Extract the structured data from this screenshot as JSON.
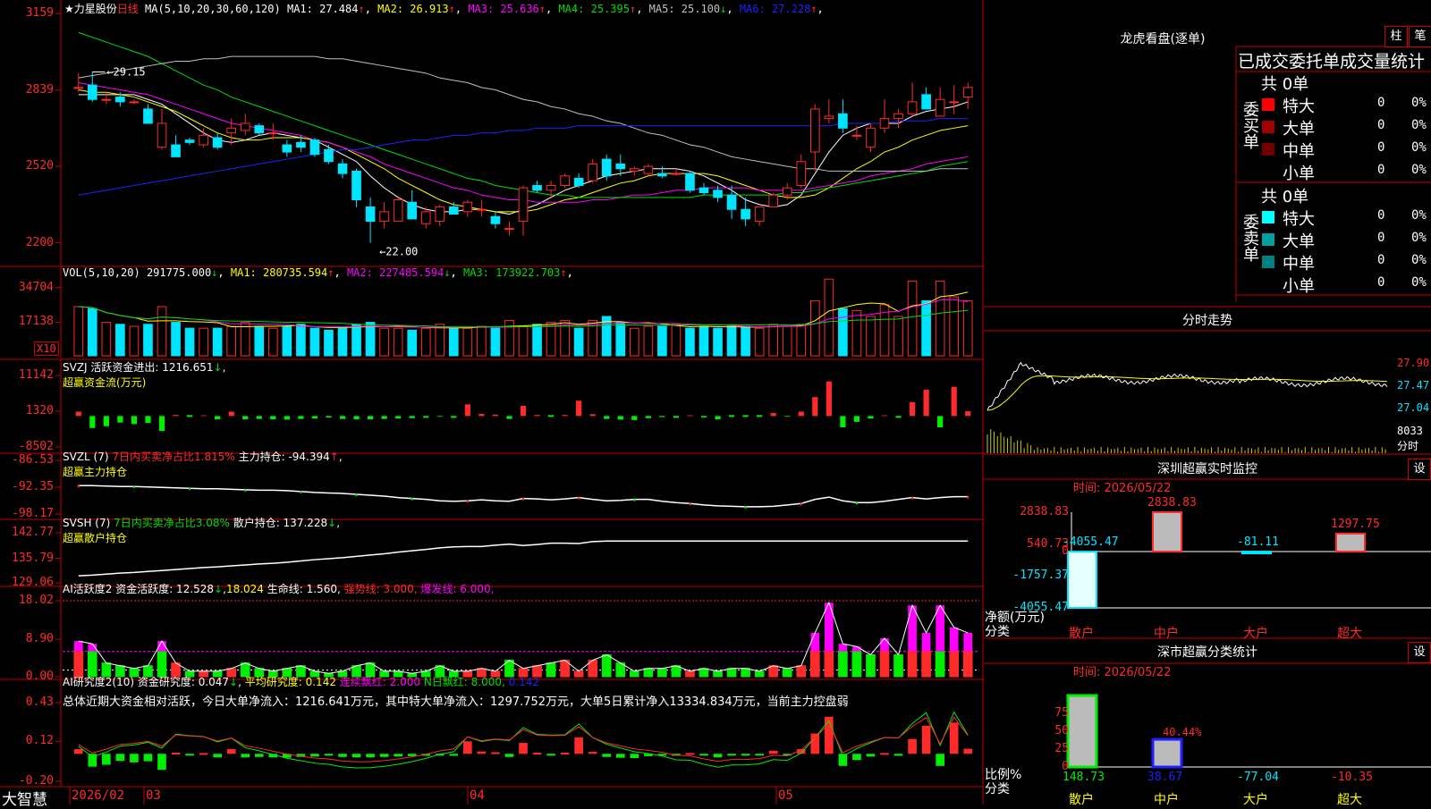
{
  "colors": {
    "up": "#ff2a2a",
    "down": "#00e5ff",
    "ma1": "#ffffff",
    "ma2": "#ffff00",
    "ma3": "#ff00ff",
    "ma4": "#00dd00",
    "ma5": "#c0c0c0",
    "ma6": "#2020ff",
    "grid": "#c00000",
    "accent": "#ffff00"
  },
  "main": {
    "title": "★力星股份",
    "period": "日线",
    "ma_label": "MA(5,10,20,30,60,120)",
    "ma_values": [
      {
        "text": "MA1: 27.484",
        "arrow": "↑",
        "color": "#ffffff"
      },
      {
        "text": "MA2: 26.913",
        "arrow": "↑",
        "color": "#ffff00"
      },
      {
        "text": "MA3: 25.636",
        "arrow": "↑",
        "color": "#ff00ff"
      },
      {
        "text": "MA4: 25.395",
        "arrow": "↑",
        "color": "#00dd00"
      },
      {
        "text": "MA5: 25.100",
        "arrow": "↓",
        "color": "#c0c0c0"
      },
      {
        "text": "MA6: 27.228",
        "arrow": "↑",
        "color": "#2020ff"
      }
    ],
    "y_labels": [
      "3159",
      "2839",
      "2520",
      "2200"
    ],
    "high_mark": "29.15",
    "low_mark": "22.00"
  },
  "vol": {
    "label": "VOL(5,10,20)",
    "value": "291775.000",
    "arrow": "↓",
    "ma": [
      {
        "text": "MA1: 280735.594",
        "arrow": "↑",
        "color": "#ffff00"
      },
      {
        "text": "MA2: 227485.594",
        "arrow": "↓",
        "color": "#ff00ff"
      },
      {
        "text": "MA3: 173922.703",
        "arrow": "↑",
        "color": "#00dd00"
      }
    ],
    "y_labels": [
      "34704",
      "17138"
    ],
    "unit": "X10"
  },
  "svzj": {
    "label": "SVZJ  活跃资金进出: 1216.651",
    "arrow": "↓",
    "sub": "超赢资金流(万元)",
    "y_labels": [
      "11142",
      "1320",
      "-8502"
    ]
  },
  "svzl": {
    "label": "SVZL (7)",
    "mid": "7日内买卖净占比1.815%",
    "tail": " 主力持仓: -94.394",
    "arrow": "↑",
    "tail2": ",",
    "sub": "超赢主力持仓",
    "y_labels": [
      "-86.53",
      "-92.35",
      "-98.17"
    ]
  },
  "svsh": {
    "label": "SVSH (7)",
    "mid": "7日内买卖净占比3.08%",
    "tail": " 散户持仓: 137.228",
    "arrow": "↓",
    "tail2": ",",
    "sub": "超赢散户持仓",
    "y_labels": [
      "142.77",
      "135.79",
      "129.06"
    ]
  },
  "ai1": {
    "label": "AI活跃度2 资金活跃度: 12.528",
    "arrow": "↓",
    "parts": [
      {
        "text": "18.024",
        "color": "#ffff00"
      },
      {
        "text": " 生命线: 1.560,",
        "color": "#ffffff"
      },
      {
        "text": " 强势线: 3.000,",
        "color": "#ff2a2a"
      },
      {
        "text": " 爆发线: 6.000,",
        "color": "#ff00ff"
      }
    ],
    "y_labels": [
      "18.02",
      "8.90",
      "0.00"
    ]
  },
  "ai2": {
    "label": "AI研究度2(10) 资金研究度: 0.047",
    "arrow": "↓",
    "parts": [
      {
        "text": " 平均研究度: 0.142",
        "color": "#ffff00"
      },
      {
        "text": " 连续飘红: 2.000",
        "color": "#ff00ff"
      },
      {
        "text": " N日飘红: 8.000,",
        "color": "#00dd00"
      },
      {
        "text": " 0.142",
        "color": "#2020ff"
      }
    ],
    "summary": "总体近期大资金相对活跃，今日大单净流入：1216.641万元，其中特大单净流入：1297.752万元，大单5日累计净入13334.834万元，当前主力控盘弱",
    "y_labels": [
      "0.43",
      "0.12",
      "-0.20"
    ]
  },
  "x_axis": {
    "brand": "大智慧",
    "labels": [
      "2026/02",
      "03",
      "04",
      "05"
    ]
  },
  "right": {
    "lhb": {
      "title": "龙虎看盘(逐单)",
      "btn_zhu": "柱",
      "btn_bi": "笔",
      "tabs": "已成交委托单成交量统计",
      "buy": {
        "side": "委买单",
        "total": "共 0单",
        "rows": [
          {
            "name": "特大",
            "val": "0",
            "pct": "0%",
            "color": "#ff0000"
          },
          {
            "name": "大单",
            "val": "0",
            "pct": "0%",
            "color": "#a00000"
          },
          {
            "name": "中单",
            "val": "0",
            "pct": "0%",
            "color": "#700000"
          },
          {
            "name": "小单",
            "val": "0",
            "pct": "0%",
            "color": ""
          }
        ]
      },
      "sell": {
        "side": "委卖单",
        "total": "共 0单",
        "rows": [
          {
            "name": "特大",
            "val": "0",
            "pct": "0%",
            "color": "#00ffff"
          },
          {
            "name": "大单",
            "val": "0",
            "pct": "0%",
            "color": "#00a0a0"
          },
          {
            "name": "中单",
            "val": "0",
            "pct": "0%",
            "color": "#008080"
          },
          {
            "name": "小单",
            "val": "0",
            "pct": "0%",
            "color": ""
          }
        ]
      }
    },
    "fenshi": {
      "title": "分时走势",
      "y_labels": [
        "27.90",
        "27.47",
        "27.04"
      ],
      "vol_label": "8033",
      "vol_unit": "分时"
    },
    "monitor": {
      "title": "深圳超赢实时监控",
      "btn": "设",
      "time": "时间: 2026/05/22",
      "y_labels": [
        "2838.83",
        "540.73",
        "0",
        "-1757.37",
        "-4055.47"
      ],
      "axis_title": "净额(万元)",
      "axis_sub": "分类",
      "bars": [
        {
          "cat": "散户",
          "value": "-4055.47"
        },
        {
          "cat": "中户",
          "value": "2838.83"
        },
        {
          "cat": "大户",
          "value": "-81.11"
        },
        {
          "cat": "超大",
          "value": "1297.75"
        }
      ]
    },
    "stats": {
      "title": "深市超赢分类统计",
      "btn": "设",
      "time": "时间: 2026/05/22",
      "y_labels": [
        "75",
        "50",
        "25",
        "0"
      ],
      "axis_title": "比例%",
      "axis_sub": "分类",
      "bars": [
        {
          "cat": "散户",
          "value": "148.73"
        },
        {
          "cat": "中户",
          "value": "38.67"
        },
        {
          "cat": "大户",
          "value": "-77.04"
        },
        {
          "cat": "超大",
          "value": "-10.35"
        }
      ],
      "mid_label": "40.44%"
    }
  },
  "chart_data": {
    "type": "candlestick",
    "candles": [
      [
        28.5,
        29.1,
        28.3,
        28.5
      ],
      [
        28.6,
        29.15,
        27.9,
        28.0
      ],
      [
        28.0,
        28.3,
        27.8,
        28.0
      ],
      [
        28.1,
        28.3,
        27.7,
        27.9
      ],
      [
        27.9,
        28.0,
        27.8,
        27.9
      ],
      [
        27.6,
        27.8,
        27.0,
        27.0
      ],
      [
        26.0,
        27.6,
        25.9,
        27.0
      ],
      [
        26.1,
        26.5,
        25.6,
        25.6
      ],
      [
        26.3,
        26.4,
        26.1,
        26.2
      ],
      [
        26.1,
        26.8,
        26.0,
        26.5
      ],
      [
        26.4,
        26.6,
        25.9,
        26.0
      ],
      [
        26.6,
        27.2,
        26.1,
        26.8
      ],
      [
        26.7,
        27.4,
        26.5,
        27.0
      ],
      [
        26.9,
        27.0,
        26.5,
        26.6
      ],
      [
        26.6,
        27.0,
        26.3,
        26.6
      ],
      [
        26.1,
        26.3,
        25.6,
        25.8
      ],
      [
        26.2,
        26.5,
        25.8,
        26.0
      ],
      [
        26.3,
        26.4,
        25.6,
        25.7
      ],
      [
        25.9,
        26.1,
        25.3,
        25.4
      ],
      [
        25.3,
        25.5,
        24.7,
        24.9
      ],
      [
        25.0,
        25.1,
        23.5,
        23.8
      ],
      [
        23.5,
        23.9,
        22.0,
        22.9
      ],
      [
        22.9,
        23.7,
        22.6,
        23.3
      ],
      [
        22.9,
        23.9,
        22.9,
        23.8
      ],
      [
        23.7,
        24.2,
        23.0,
        23.0
      ],
      [
        22.8,
        23.5,
        22.6,
        23.3
      ],
      [
        22.9,
        23.6,
        22.7,
        23.5
      ],
      [
        23.5,
        23.7,
        23.2,
        23.2
      ],
      [
        23.3,
        23.8,
        23.1,
        23.7
      ],
      [
        23.4,
        23.8,
        23.1,
        23.4
      ],
      [
        23.1,
        23.3,
        22.6,
        22.8
      ],
      [
        22.6,
        22.9,
        22.3,
        22.6
      ],
      [
        22.9,
        24.4,
        22.3,
        24.3
      ],
      [
        24.4,
        24.6,
        24.1,
        24.2
      ],
      [
        24.2,
        24.6,
        23.9,
        24.4
      ],
      [
        24.4,
        24.9,
        24.3,
        24.8
      ],
      [
        24.7,
        24.9,
        24.3,
        24.4
      ],
      [
        24.6,
        25.5,
        24.5,
        25.3
      ],
      [
        25.5,
        25.7,
        24.6,
        24.8
      ],
      [
        25.3,
        25.7,
        24.8,
        25.1
      ],
      [
        25.0,
        25.2,
        24.8,
        25.1
      ],
      [
        24.9,
        25.3,
        24.8,
        25.2
      ],
      [
        24.9,
        25.2,
        24.7,
        24.8
      ],
      [
        24.9,
        25.1,
        24.8,
        24.9
      ],
      [
        24.9,
        25.0,
        24.1,
        24.2
      ],
      [
        24.3,
        24.5,
        24.0,
        24.1
      ],
      [
        24.2,
        24.4,
        23.7,
        23.9
      ],
      [
        24.0,
        24.4,
        23.0,
        23.4
      ],
      [
        23.4,
        23.9,
        22.7,
        23.0
      ],
      [
        22.9,
        23.5,
        22.7,
        23.5
      ],
      [
        23.5,
        24.1,
        23.5,
        24.0
      ],
      [
        24.0,
        24.5,
        23.8,
        24.3
      ],
      [
        24.4,
        25.7,
        24.3,
        25.4
      ],
      [
        25.8,
        27.8,
        25.0,
        27.6
      ],
      [
        27.2,
        28.0,
        27.0,
        27.3
      ],
      [
        27.4,
        28.0,
        26.6,
        26.8
      ],
      [
        26.5,
        26.9,
        26.3,
        26.5
      ],
      [
        26.0,
        27.0,
        25.8,
        26.8
      ],
      [
        26.8,
        28.0,
        26.6,
        27.2
      ],
      [
        27.2,
        27.6,
        26.8,
        27.4
      ],
      [
        27.4,
        28.7,
        27.3,
        27.9
      ],
      [
        28.2,
        28.5,
        27.6,
        27.6
      ],
      [
        27.3,
        28.5,
        27.3,
        28.0
      ],
      [
        27.9,
        28.6,
        27.4,
        27.9
      ],
      [
        28.1,
        28.7,
        27.6,
        28.5
      ]
    ],
    "ma": [
      {
        "name": "MA1",
        "color": "#ffffff",
        "values": [
          28.2,
          28.2,
          28.2,
          28.2,
          28.2,
          28.0,
          27.8,
          27.4,
          27.0,
          26.6,
          26.3,
          26.2,
          26.3,
          26.5,
          26.6,
          26.5,
          26.4,
          26.3,
          26.0,
          25.7,
          25.4,
          24.8,
          24.3,
          23.9,
          23.6,
          23.4,
          23.3,
          23.3,
          23.4,
          23.4,
          23.3,
          23.2,
          23.4,
          23.6,
          23.9,
          24.2,
          24.4,
          24.6,
          24.8,
          24.9,
          25.0,
          25.1,
          25.1,
          25.1,
          25.0,
          24.8,
          24.5,
          24.2,
          23.8,
          23.6,
          23.5,
          23.6,
          24.0,
          24.9,
          25.8,
          26.5,
          26.8,
          27.0,
          27.0,
          27.0,
          27.3,
          27.5,
          27.6,
          27.7,
          27.9
        ]
      },
      {
        "name": "MA2",
        "color": "#ffff00",
        "values": [
          28.4,
          28.3,
          28.3,
          28.2,
          28.1,
          27.9,
          27.7,
          27.5,
          27.2,
          26.9,
          26.6,
          26.4,
          26.3,
          26.3,
          26.4,
          26.4,
          26.4,
          26.3,
          26.2,
          26.0,
          25.7,
          25.4,
          25.1,
          24.7,
          24.4,
          24.1,
          23.8,
          23.6,
          23.5,
          23.4,
          23.3,
          23.3,
          23.3,
          23.4,
          23.6,
          23.8,
          23.9,
          24.1,
          24.3,
          24.5,
          24.6,
          24.8,
          24.9,
          24.9,
          24.9,
          24.9,
          24.8,
          24.6,
          24.4,
          24.2,
          24.0,
          23.9,
          23.9,
          24.0,
          24.3,
          24.7,
          25.1,
          25.4,
          25.8,
          26.0,
          26.3,
          26.5,
          26.7,
          26.8,
          26.9
        ]
      },
      {
        "name": "MA3",
        "color": "#ff00ff",
        "values": [
          28.7,
          28.6,
          28.5,
          28.4,
          28.3,
          28.2,
          28.0,
          27.8,
          27.6,
          27.4,
          27.2,
          27.0,
          26.9,
          26.8,
          26.7,
          26.6,
          26.5,
          26.3,
          26.2,
          26.0,
          25.8,
          25.6,
          25.3,
          25.1,
          24.9,
          24.7,
          24.5,
          24.3,
          24.2,
          24.0,
          23.9,
          23.8,
          23.8,
          23.7,
          23.7,
          23.7,
          23.7,
          23.8,
          23.8,
          23.9,
          24.0,
          24.0,
          24.1,
          24.2,
          24.2,
          24.3,
          24.3,
          24.3,
          24.3,
          24.2,
          24.2,
          24.2,
          24.2,
          24.3,
          24.4,
          24.5,
          24.6,
          24.8,
          24.9,
          25.0,
          25.1,
          25.3,
          25.4,
          25.5,
          25.6
        ]
      },
      {
        "name": "MA4",
        "color": "#00dd00",
        "values": [
          30.8,
          30.6,
          30.4,
          30.2,
          30.0,
          29.8,
          29.5,
          29.2,
          28.9,
          28.6,
          28.4,
          28.1,
          27.9,
          27.7,
          27.5,
          27.3,
          27.1,
          26.9,
          26.7,
          26.5,
          26.3,
          26.1,
          25.9,
          25.7,
          25.5,
          25.3,
          25.1,
          24.9,
          24.7,
          24.6,
          24.4,
          24.3,
          24.2,
          24.1,
          24.0,
          24.0,
          23.9,
          23.9,
          23.9,
          23.9,
          23.9,
          23.9,
          23.9,
          23.9,
          23.9,
          24.0,
          24.0,
          24.0,
          24.0,
          24.0,
          24.0,
          24.1,
          24.1,
          24.2,
          24.3,
          24.4,
          24.5,
          24.6,
          24.7,
          24.8,
          24.9,
          25.0,
          25.2,
          25.3,
          25.4
        ]
      },
      {
        "name": "MA5",
        "color": "#c0c0c0",
        "values": [
          28.9,
          29.0,
          29.1,
          29.2,
          29.3,
          29.4,
          29.5,
          29.6,
          29.6,
          29.7,
          29.7,
          29.8,
          29.8,
          29.8,
          29.8,
          29.8,
          29.8,
          29.8,
          29.7,
          29.7,
          29.6,
          29.5,
          29.4,
          29.3,
          29.2,
          29.1,
          28.9,
          28.8,
          28.7,
          28.5,
          28.4,
          28.2,
          28.0,
          27.9,
          27.7,
          27.6,
          27.4,
          27.3,
          27.1,
          27.0,
          26.8,
          26.6,
          26.5,
          26.3,
          26.1,
          26.0,
          25.8,
          25.6,
          25.5,
          25.4,
          25.3,
          25.2,
          25.1,
          25.1,
          25.0,
          25.0,
          25.0,
          25.0,
          25.0,
          25.0,
          25.0,
          25.0,
          25.1,
          25.1,
          25.1
        ]
      },
      {
        "name": "MA6",
        "color": "#2020ff",
        "values": [
          24.0,
          24.1,
          24.2,
          24.3,
          24.4,
          24.5,
          24.6,
          24.7,
          24.8,
          24.9,
          25.0,
          25.1,
          25.2,
          25.3,
          25.4,
          25.5,
          25.6,
          25.7,
          25.8,
          25.9,
          25.9,
          26.0,
          26.1,
          26.2,
          26.3,
          26.3,
          26.4,
          26.5,
          26.5,
          26.6,
          26.6,
          26.7,
          26.7,
          26.8,
          26.8,
          26.8,
          26.9,
          26.9,
          26.9,
          26.9,
          26.9,
          26.9,
          26.9,
          26.9,
          26.9,
          26.9,
          26.9,
          26.9,
          26.9,
          26.9,
          26.9,
          26.9,
          26.9,
          26.9,
          26.9,
          27.0,
          27.0,
          27.0,
          27.0,
          27.1,
          27.1,
          27.1,
          27.2,
          27.2,
          27.2
        ]
      }
    ],
    "volume": [
      25,
      24,
      17,
      16,
      15,
      16,
      25,
      17,
      14,
      14,
      14,
      15,
      17,
      15,
      14,
      15,
      16,
      14,
      13,
      14,
      16,
      17,
      14,
      14,
      13,
      14,
      16,
      14,
      14,
      15,
      14,
      18,
      15,
      16,
      17,
      18,
      14,
      18,
      20,
      17,
      14,
      15,
      15,
      16,
      14,
      15,
      14,
      15,
      15,
      14,
      16,
      15,
      16,
      28,
      39,
      24,
      23,
      20,
      26,
      20,
      38,
      28,
      38,
      30,
      28
    ],
    "svzj": [
      1200,
      -3300,
      -2800,
      -1800,
      -2200,
      -1900,
      -4100,
      300,
      0,
      200,
      -900,
      1200,
      -900,
      -800,
      -900,
      -1000,
      -800,
      -700,
      -400,
      -800,
      -900,
      -900,
      -800,
      -700,
      -600,
      -500,
      -200,
      -500,
      3200,
      600,
      400,
      -800,
      2800,
      300,
      0,
      300,
      4200,
      500,
      -800,
      -1000,
      -1100,
      -600,
      -300,
      -500,
      200,
      -400,
      -900,
      0,
      0,
      0,
      800,
      -200,
      1200,
      5200,
      9500,
      -3100,
      -1600,
      -700,
      200,
      -500,
      3800,
      7200,
      -3100,
      8000,
      1300
    ],
    "svzl": [
      -92.0,
      -92.0,
      -92.1,
      -92.2,
      -92.2,
      -92.3,
      -92.4,
      -92.5,
      -92.6,
      -92.7,
      -92.7,
      -92.8,
      -92.9,
      -93.0,
      -93.0,
      -93.1,
      -93.3,
      -93.5,
      -93.6,
      -93.7,
      -93.9,
      -94.1,
      -94.3,
      -94.6,
      -94.8,
      -95.0,
      -95.3,
      -95.4,
      -95.3,
      -95.1,
      -95.3,
      -95.4,
      -94.8,
      -94.9,
      -95.1,
      -94.9,
      -94.6,
      -95.0,
      -95.3,
      -95.2,
      -95.0,
      -95.0,
      -95.4,
      -95.7,
      -95.9,
      -96.2,
      -96.4,
      -96.5,
      -96.6,
      -96.6,
      -96.5,
      -96.2,
      -95.9,
      -95.0,
      -94.5,
      -95.3,
      -95.7,
      -95.7,
      -95.4,
      -95.0,
      -94.6,
      -94.9,
      -94.6,
      -94.4,
      -94.4
    ]
  }
}
